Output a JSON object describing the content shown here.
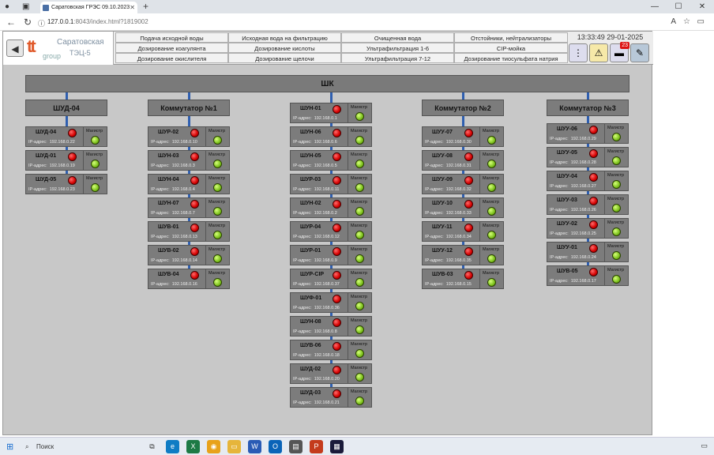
{
  "browser": {
    "tab_title": "Саратовская ГРЭС 09.10.2023",
    "url_host": "127.0.0.1",
    "url_rest": ":8043/index.html?1819002"
  },
  "logo": {
    "line1": "Саратовская",
    "line2": "ТЭЦ-5",
    "group": "group"
  },
  "menu": [
    "Подача исходной воды",
    "Исходная вода на фильтрацию",
    "Очищенная вода",
    "Отстойники, нейтрализаторы",
    "Дозирование коагулянта",
    "Дозирование кислоты",
    "Ультрафильтрация 1-6",
    "CIP-мойка",
    "Дозирование окислителя",
    "Дозирование щелочи",
    "Ультрафильтрация 7-12",
    "Дозирование тиосульфата натрия"
  ],
  "clock": "13:33:49 29-01-2025",
  "alarm_count": "23",
  "shk_label": "ШК",
  "mag_label": "Магистр",
  "ip_prefix": "IP-адрес:",
  "colors": {
    "led_red": "#d40000",
    "led_green": "#7dc21e",
    "link_line": "#2f5fb0"
  },
  "groups": [
    {
      "title": "ШУД-04",
      "nodes": [
        {
          "name": "ШУД-04",
          "ip": "192.168.0.22"
        },
        {
          "name": "ШУД-01",
          "ip": "192.168.0.19"
        },
        {
          "name": "ШУД-05",
          "ip": "192.168.0.23"
        }
      ]
    },
    {
      "title": "Коммутатор №1",
      "nodes": [
        {
          "name": "ШУР-02",
          "ip": "192.168.0.10"
        },
        {
          "name": "ШУН-03",
          "ip": "192.168.0.3"
        },
        {
          "name": "ШУН-04",
          "ip": "192.168.0.4"
        },
        {
          "name": "ШУН-07",
          "ip": "192.168.0.7"
        },
        {
          "name": "ШУВ-01",
          "ip": "192.168.0.13"
        },
        {
          "name": "ШУВ-02",
          "ip": "192.168.0.14"
        },
        {
          "name": "ШУВ-04",
          "ip": "192.168.0.16"
        }
      ]
    },
    {
      "title": "",
      "nodes": [
        {
          "name": "ШУН-01",
          "ip": "192.168.0.1"
        },
        {
          "name": "ШУН-06",
          "ip": "192.168.0.6"
        },
        {
          "name": "ШУН-05",
          "ip": "192.168.0.5"
        },
        {
          "name": "ШУР-03",
          "ip": "192.168.0.11"
        },
        {
          "name": "ШУН-02",
          "ip": "192.168.0.2"
        },
        {
          "name": "ШУР-04",
          "ip": "192.168.0.12"
        },
        {
          "name": "ШУР-01",
          "ip": "192.168.0.9"
        },
        {
          "name": "ШУР-CIP",
          "ip": "192.168.0.37"
        },
        {
          "name": "ШУФ-01",
          "ip": "192.168.0.36"
        },
        {
          "name": "ШУН-08",
          "ip": "192.168.0.8"
        },
        {
          "name": "ШУВ-06",
          "ip": "192.168.0.18"
        },
        {
          "name": "ШУД-02",
          "ip": "192.168.0.20"
        },
        {
          "name": "ШУД-03",
          "ip": "192.168.0.21"
        }
      ]
    },
    {
      "title": "Коммутатор №2",
      "nodes": [
        {
          "name": "ШУУ-07",
          "ip": "192.168.0.30"
        },
        {
          "name": "ШУУ-08",
          "ip": "192.168.0.31"
        },
        {
          "name": "ШУУ-09",
          "ip": "192.168.0.32"
        },
        {
          "name": "ШУУ-10",
          "ip": "192.168.0.33"
        },
        {
          "name": "ШУУ-11",
          "ip": "192.168.0.34"
        },
        {
          "name": "ШУУ-12",
          "ip": "192.168.0.35"
        },
        {
          "name": "ШУВ-03",
          "ip": "192.168.0.15"
        }
      ]
    },
    {
      "title": "Коммутатор №3",
      "nodes": [
        {
          "name": "ШУУ-06",
          "ip": "192.168.0.29"
        },
        {
          "name": "ШУУ-05",
          "ip": "192.168.0.28"
        },
        {
          "name": "ШУУ-04",
          "ip": "192.168.0.27"
        },
        {
          "name": "ШУУ-03",
          "ip": "192.168.0.26"
        },
        {
          "name": "ШУУ-02",
          "ip": "192.168.0.25"
        },
        {
          "name": "ШУУ-01",
          "ip": "192.168.0.24"
        },
        {
          "name": "ШУВ-05",
          "ip": "192.168.0.17"
        }
      ]
    }
  ],
  "taskbar": {
    "search_label": "Поиск"
  }
}
